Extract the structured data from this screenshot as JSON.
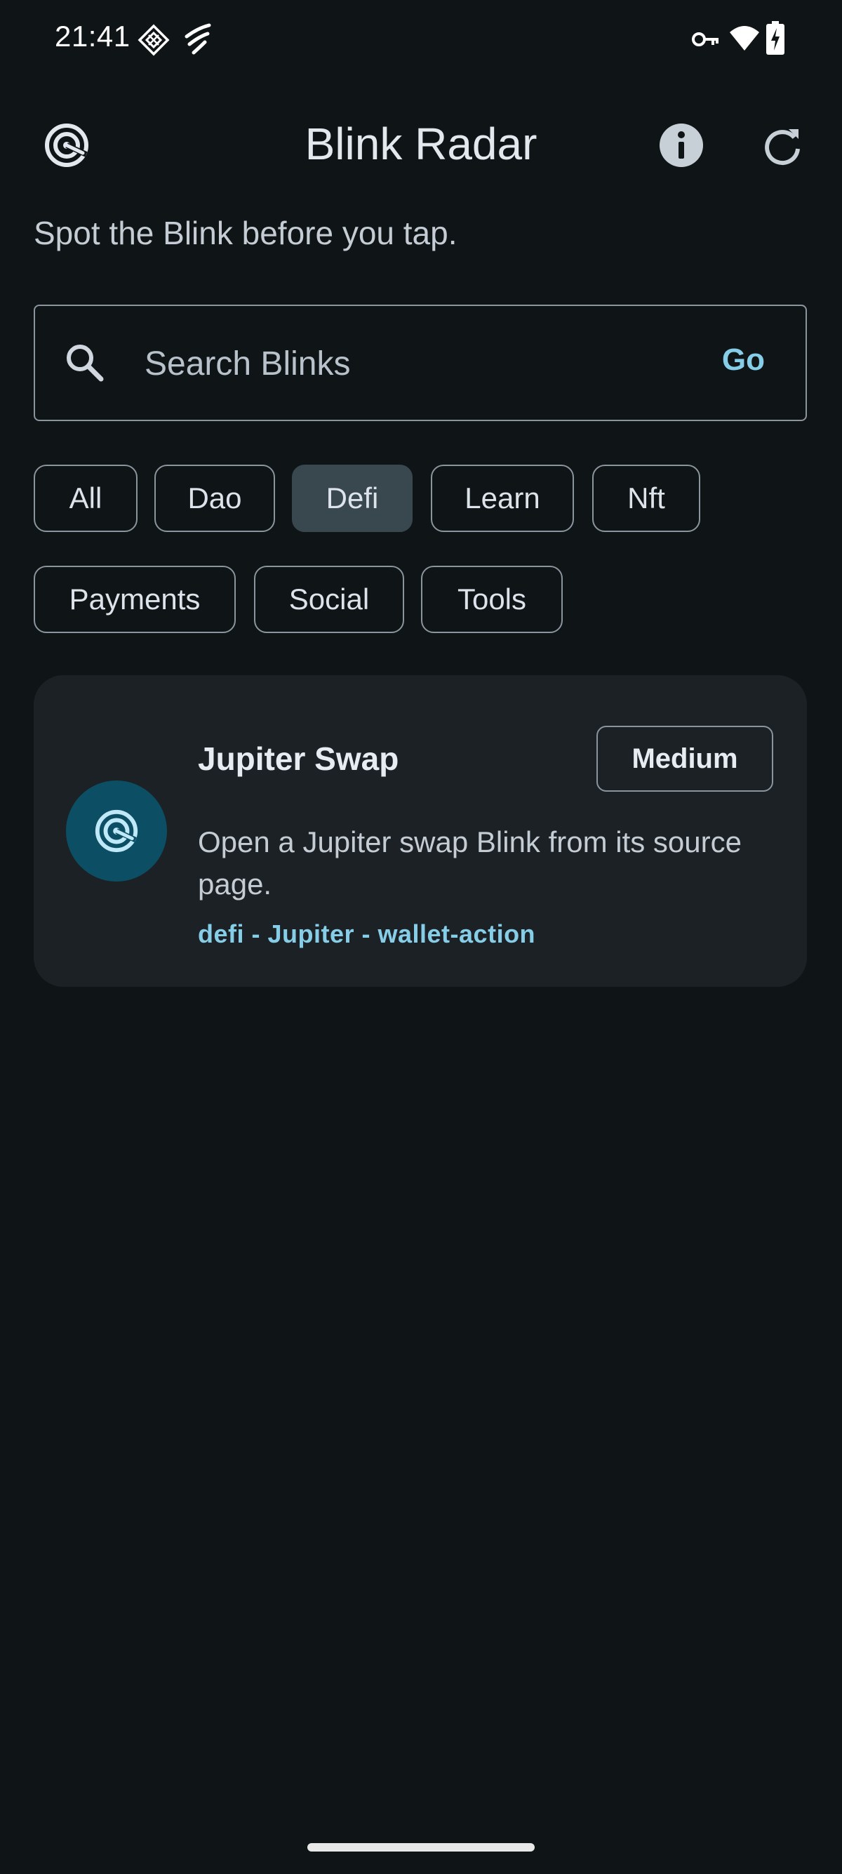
{
  "status_bar": {
    "time": "21:41"
  },
  "app_bar": {
    "title": "Blink Radar",
    "info_label": "info",
    "refresh_label": "refresh"
  },
  "subtitle": "Spot the Blink before you tap.",
  "search": {
    "placeholder": "Search Blinks",
    "value": "",
    "go_label": "Go"
  },
  "filters": {
    "selected": "Defi",
    "chips": [
      "All",
      "Dao",
      "Defi",
      "Learn",
      "Nft",
      "Payments",
      "Social",
      "Tools"
    ]
  },
  "results": [
    {
      "title": "Jupiter Swap",
      "risk": "Medium",
      "description": "Open a Jupiter swap Blink from its source page.",
      "tags": "defi - Jupiter - wallet-action",
      "icon": "radar-icon"
    }
  ],
  "colors": {
    "background": "#0f1417",
    "card": "#1c2126",
    "accent": "#86cde8",
    "chip_selected": "#39474f",
    "avatar": "#0c4f64"
  }
}
